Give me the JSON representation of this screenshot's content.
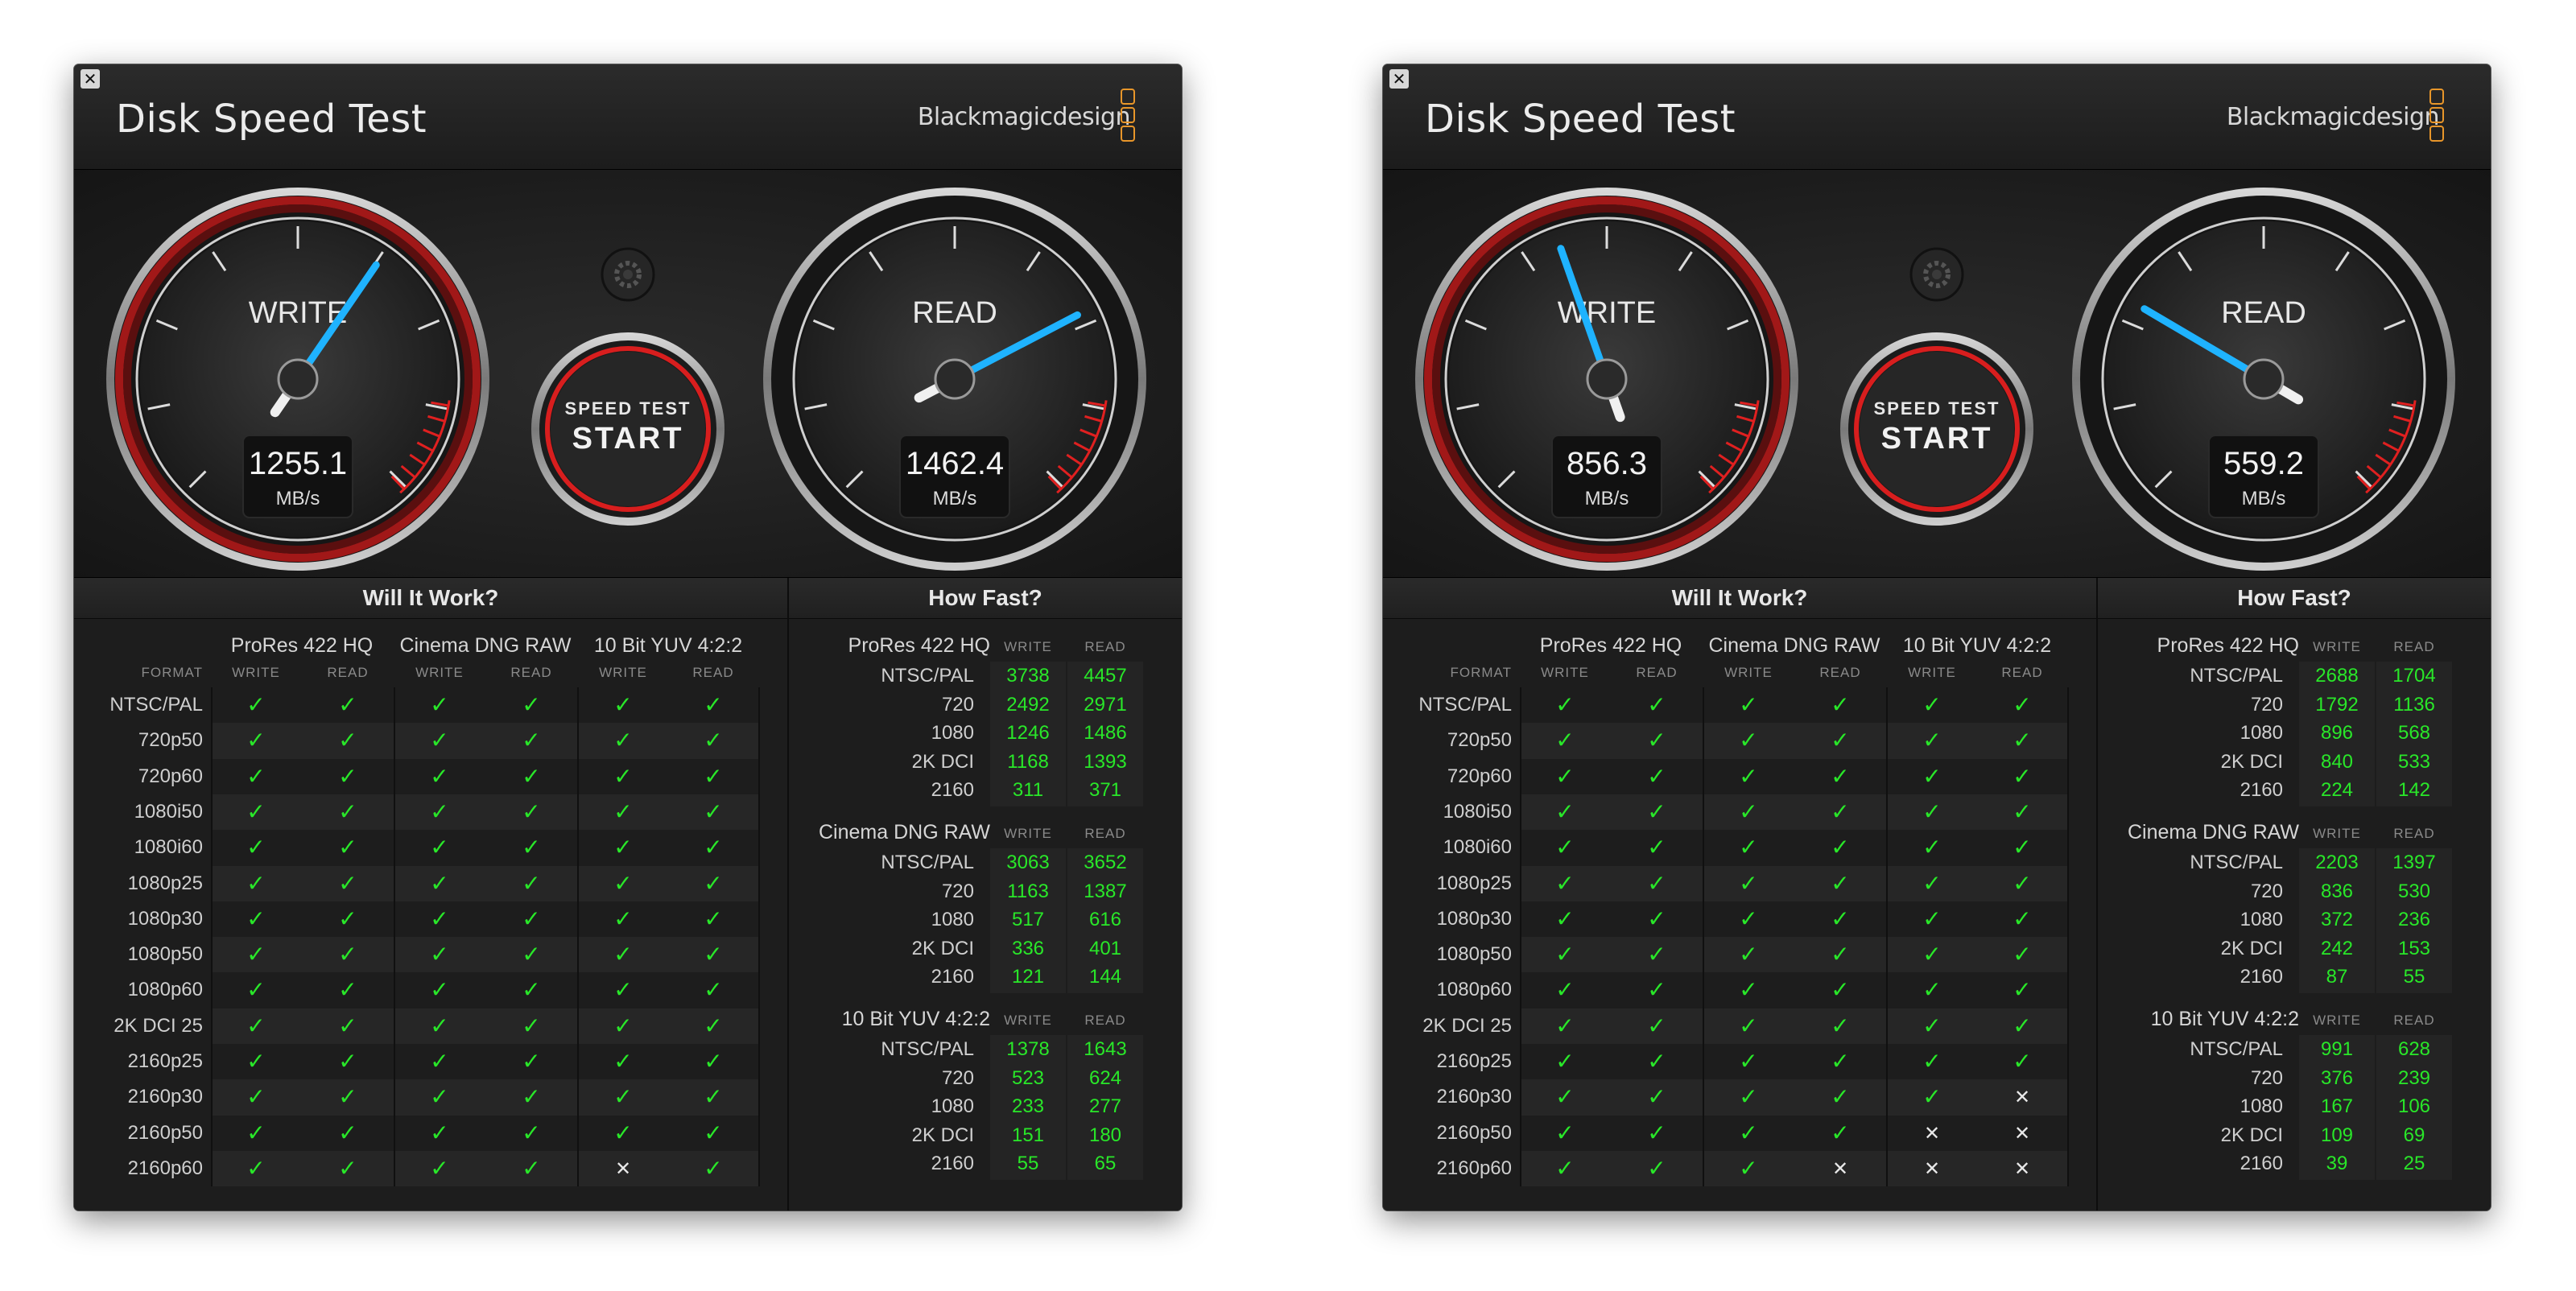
{
  "app": {
    "title": "Disk Speed Test",
    "brand": "Blackmagicdesign",
    "close_glyph": "✕",
    "accent_color": "#29e729",
    "needle_color": "#1fb3ff",
    "redline_color": "#e02020",
    "brand_mark_color": "#e8962a"
  },
  "gauge_labels": {
    "write": "WRITE",
    "read": "READ",
    "unit": "MB/s",
    "start_top": "SPEED TEST",
    "start_bottom": "START",
    "settings_icon": "gear-icon"
  },
  "sections": {
    "will_it_work": "Will It Work?",
    "how_fast": "How Fast?"
  },
  "labels": {
    "format": "FORMAT",
    "write": "WRITE",
    "read": "READ",
    "codecs": [
      "ProRes 422 HQ",
      "Cinema DNG RAW",
      "10 Bit YUV 4:2:2"
    ],
    "formats": [
      "NTSC/PAL",
      "720p50",
      "720p60",
      "1080i50",
      "1080i60",
      "1080p25",
      "1080p30",
      "1080p50",
      "1080p60",
      "2K DCI 25",
      "2160p25",
      "2160p30",
      "2160p50",
      "2160p60"
    ],
    "fast_rows": [
      "NTSC/PAL",
      "720",
      "1080",
      "2K DCI",
      "2160"
    ]
  },
  "windows": [
    {
      "write_speed": "1255.1",
      "read_speed": "1462.4",
      "will_it_work": [
        [
          1,
          1,
          1,
          1,
          1,
          1
        ],
        [
          1,
          1,
          1,
          1,
          1,
          1
        ],
        [
          1,
          1,
          1,
          1,
          1,
          1
        ],
        [
          1,
          1,
          1,
          1,
          1,
          1
        ],
        [
          1,
          1,
          1,
          1,
          1,
          1
        ],
        [
          1,
          1,
          1,
          1,
          1,
          1
        ],
        [
          1,
          1,
          1,
          1,
          1,
          1
        ],
        [
          1,
          1,
          1,
          1,
          1,
          1
        ],
        [
          1,
          1,
          1,
          1,
          1,
          1
        ],
        [
          1,
          1,
          1,
          1,
          1,
          1
        ],
        [
          1,
          1,
          1,
          1,
          1,
          1
        ],
        [
          1,
          1,
          1,
          1,
          1,
          1
        ],
        [
          1,
          1,
          1,
          1,
          1,
          1
        ],
        [
          1,
          1,
          1,
          1,
          0,
          1
        ]
      ],
      "how_fast": [
        {
          "write": [
            "3738",
            "2492",
            "1246",
            "1168",
            "311"
          ],
          "read": [
            "4457",
            "2971",
            "1486",
            "1393",
            "371"
          ]
        },
        {
          "write": [
            "3063",
            "1163",
            "517",
            "336",
            "121"
          ],
          "read": [
            "3652",
            "1387",
            "616",
            "401",
            "144"
          ]
        },
        {
          "write": [
            "1378",
            "523",
            "233",
            "151",
            "55"
          ],
          "read": [
            "1643",
            "624",
            "277",
            "180",
            "65"
          ]
        }
      ]
    },
    {
      "write_speed": "856.3",
      "read_speed": "559.2",
      "will_it_work": [
        [
          1,
          1,
          1,
          1,
          1,
          1
        ],
        [
          1,
          1,
          1,
          1,
          1,
          1
        ],
        [
          1,
          1,
          1,
          1,
          1,
          1
        ],
        [
          1,
          1,
          1,
          1,
          1,
          1
        ],
        [
          1,
          1,
          1,
          1,
          1,
          1
        ],
        [
          1,
          1,
          1,
          1,
          1,
          1
        ],
        [
          1,
          1,
          1,
          1,
          1,
          1
        ],
        [
          1,
          1,
          1,
          1,
          1,
          1
        ],
        [
          1,
          1,
          1,
          1,
          1,
          1
        ],
        [
          1,
          1,
          1,
          1,
          1,
          1
        ],
        [
          1,
          1,
          1,
          1,
          1,
          1
        ],
        [
          1,
          1,
          1,
          1,
          1,
          0
        ],
        [
          1,
          1,
          1,
          1,
          0,
          0
        ],
        [
          1,
          1,
          1,
          0,
          0,
          0
        ]
      ],
      "how_fast": [
        {
          "write": [
            "2688",
            "1792",
            "896",
            "840",
            "224"
          ],
          "read": [
            "1704",
            "1136",
            "568",
            "533",
            "142"
          ]
        },
        {
          "write": [
            "2203",
            "836",
            "372",
            "242",
            "87"
          ],
          "read": [
            "1397",
            "530",
            "236",
            "153",
            "55"
          ]
        },
        {
          "write": [
            "991",
            "376",
            "167",
            "109",
            "39"
          ],
          "read": [
            "628",
            "239",
            "106",
            "69",
            "25"
          ]
        }
      ]
    }
  ]
}
